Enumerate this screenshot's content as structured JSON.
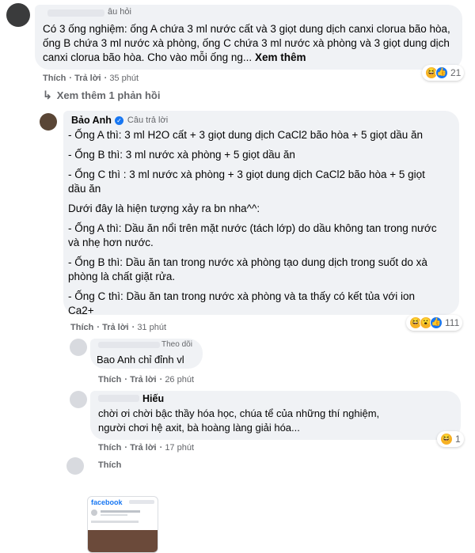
{
  "top_comment": {
    "author_badge": "âu hỏi",
    "text": "Có 3 ống nghiệm: ống A chứa 3 ml nước cất và 3 giọt dung dịch canxi clorua bão hòa, ống B chứa 3 ml nước xà phòng, ống C chứa 3 ml nước xà phòng và 3 giọt dung dịch canxi clorua bão hòa. Cho vào mỗi ống ng...",
    "see_more": "Xem thêm",
    "like": "Thích",
    "reply": "Trả lời",
    "time": "35 phút",
    "reaction_count": "21"
  },
  "view_more_replies": "Xem thêm 1 phản hồi",
  "reply1": {
    "author": "Bảo Anh",
    "badge": "Câu trả lời",
    "lines": [
      "- Ống A thì: 3 ml H2O cất + 3 giọt dung dịch CaCl2 bão hòa + 5 giọt dầu ăn",
      "- Ống B thì: 3 ml nước xà phòng + 5 giọt dầu ăn",
      "- Ống C thì : 3 ml nước xà phòng + 3 giọt dung dịch CaCl2 bão hòa + 5 giọt",
      "dầu ăn",
      "Dưới đây là hiện tượng xảy ra bn nha^^:",
      "- Ống A thì: Dầu ăn nổi trên mặt nước (tách lớp) do dầu không tan trong nước",
      "và nhẹ hơn nước.",
      "- Ống B thì: Dầu ăn tan trong nước xà phòng tạo dung dịch trong suốt do xà",
      "phòng là chất giặt rửa.",
      "- Ống C thì: Dầu ăn tan trong nước xà phòng và ta thấy có kết tủa với ion",
      "Ca2+"
    ],
    "like": "Thích",
    "reply": "Trả lời",
    "time": "31 phút",
    "reaction_count": "111"
  },
  "reply2": {
    "badge": "Theo dõi",
    "text": "Bao Anh chỉ đỉnh vl",
    "like": "Thích",
    "reply": "Trả lời",
    "time": "26 phút"
  },
  "reply3": {
    "author": "Hiếu",
    "lines": [
      "chời ơi chời bậc thầy hóa học, chúa tể của những thí nghiệm,",
      "người chơi hệ axit, bà hoàng làng giải hóa..."
    ],
    "like": "Thích",
    "reply": "Trả lời",
    "time": "17 phút",
    "reaction_count": "1"
  },
  "reply4": {
    "like": "Thích"
  },
  "attachment": {
    "brand": "facebook"
  },
  "colors": {
    "bubble": "#f0f2f5",
    "meta": "#65676b",
    "verified": "#1877f2",
    "fb_blue": "#1877f2"
  }
}
